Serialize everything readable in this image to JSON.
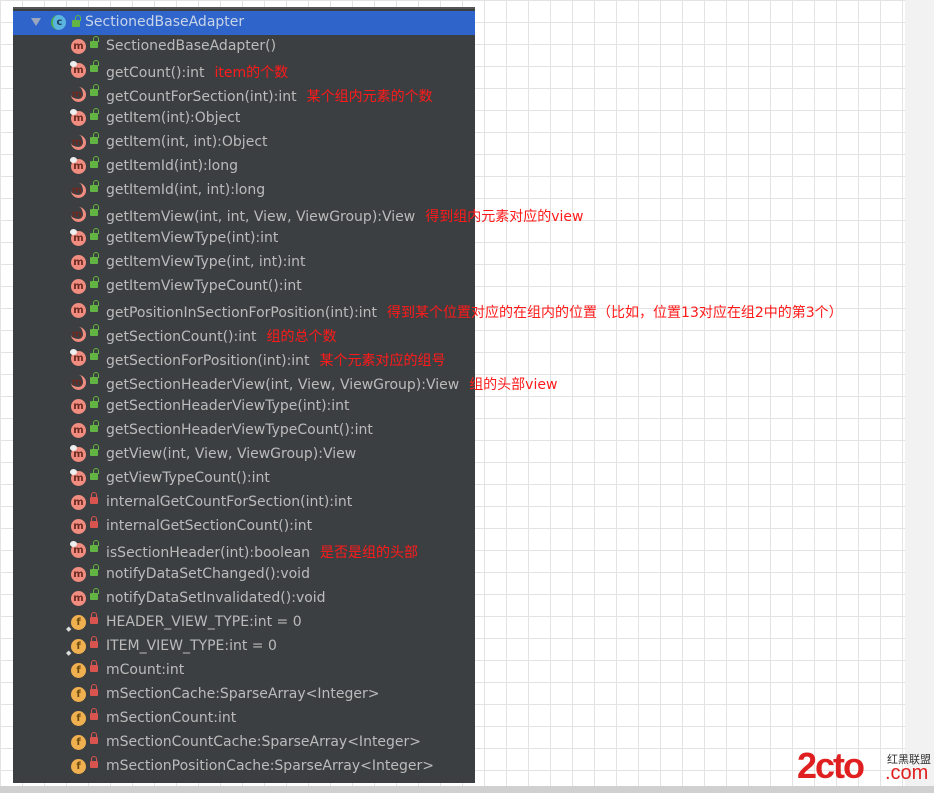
{
  "header": {
    "title": "SectionedBaseAdapter",
    "icon": "class-icon"
  },
  "members": [
    {
      "label": "SectionedBaseAdapter()",
      "kind": "m",
      "mod": "",
      "access": "pub",
      "note": ""
    },
    {
      "label": "getCount():int",
      "kind": "m",
      "mod": "o",
      "access": "pub",
      "note": "item的个数"
    },
    {
      "label": "getCountForSection(int):int",
      "kind": "m",
      "mod": "a",
      "access": "pub",
      "note": "某个组内元素的个数"
    },
    {
      "label": "getItem(int):Object",
      "kind": "m",
      "mod": "o",
      "access": "pub",
      "note": ""
    },
    {
      "label": "getItem(int, int):Object",
      "kind": "m",
      "mod": "a",
      "access": "pub",
      "note": ""
    },
    {
      "label": "getItemId(int):long",
      "kind": "m",
      "mod": "o",
      "access": "pub",
      "note": ""
    },
    {
      "label": "getItemId(int, int):long",
      "kind": "m",
      "mod": "a",
      "access": "pub",
      "note": ""
    },
    {
      "label": "getItemView(int, int, View, ViewGroup):View",
      "kind": "m",
      "mod": "a",
      "access": "pub",
      "note": "得到组内元素对应的view"
    },
    {
      "label": "getItemViewType(int):int",
      "kind": "m",
      "mod": "o",
      "access": "pub",
      "note": ""
    },
    {
      "label": "getItemViewType(int, int):int",
      "kind": "m",
      "mod": "",
      "access": "pub",
      "note": ""
    },
    {
      "label": "getItemViewTypeCount():int",
      "kind": "m",
      "mod": "",
      "access": "pub",
      "note": ""
    },
    {
      "label": "getPositionInSectionForPosition(int):int",
      "kind": "m",
      "mod": "",
      "access": "pub",
      "note": "得到某个位置对应的在组内的位置（比如，位置13对应在组2中的第3个）"
    },
    {
      "label": "getSectionCount():int",
      "kind": "m",
      "mod": "a",
      "access": "pub",
      "note": "组的总个数"
    },
    {
      "label": "getSectionForPosition(int):int",
      "kind": "m",
      "mod": "o",
      "access": "pub",
      "note": "某个元素对应的组号"
    },
    {
      "label": "getSectionHeaderView(int, View, ViewGroup):View",
      "kind": "m",
      "mod": "a",
      "access": "pub",
      "note": "组的头部view"
    },
    {
      "label": "getSectionHeaderViewType(int):int",
      "kind": "m",
      "mod": "",
      "access": "pub",
      "note": ""
    },
    {
      "label": "getSectionHeaderViewTypeCount():int",
      "kind": "m",
      "mod": "",
      "access": "pub",
      "note": ""
    },
    {
      "label": "getView(int, View, ViewGroup):View",
      "kind": "m",
      "mod": "o",
      "access": "pub",
      "note": ""
    },
    {
      "label": "getViewTypeCount():int",
      "kind": "m",
      "mod": "o",
      "access": "pub",
      "note": ""
    },
    {
      "label": "internalGetCountForSection(int):int",
      "kind": "m",
      "mod": "",
      "access": "priv",
      "note": ""
    },
    {
      "label": "internalGetSectionCount():int",
      "kind": "m",
      "mod": "",
      "access": "priv",
      "note": ""
    },
    {
      "label": "isSectionHeader(int):boolean",
      "kind": "m",
      "mod": "o",
      "access": "pub",
      "note": "是否是组的头部"
    },
    {
      "label": "notifyDataSetChanged():void",
      "kind": "m",
      "mod": "",
      "access": "pub",
      "note": ""
    },
    {
      "label": "notifyDataSetInvalidated():void",
      "kind": "m",
      "mod": "",
      "access": "pub",
      "note": ""
    },
    {
      "label": "HEADER_VIEW_TYPE:int = 0",
      "kind": "f",
      "mod": "s",
      "access": "priv",
      "note": ""
    },
    {
      "label": "ITEM_VIEW_TYPE:int = 0",
      "kind": "f",
      "mod": "s",
      "access": "priv",
      "note": ""
    },
    {
      "label": "mCount:int",
      "kind": "f",
      "mod": "",
      "access": "priv",
      "note": ""
    },
    {
      "label": "mSectionCache:SparseArray<Integer>",
      "kind": "f",
      "mod": "",
      "access": "priv",
      "note": ""
    },
    {
      "label": "mSectionCount:int",
      "kind": "f",
      "mod": "",
      "access": "priv",
      "note": ""
    },
    {
      "label": "mSectionCountCache:SparseArray<Integer>",
      "kind": "f",
      "mod": "",
      "access": "priv",
      "note": ""
    },
    {
      "label": "mSectionPositionCache:SparseArray<Integer>",
      "kind": "f",
      "mod": "",
      "access": "priv",
      "note": ""
    }
  ],
  "watermark": {
    "logo": "2cto",
    "cn": "红黑联盟",
    "com": ".com"
  }
}
